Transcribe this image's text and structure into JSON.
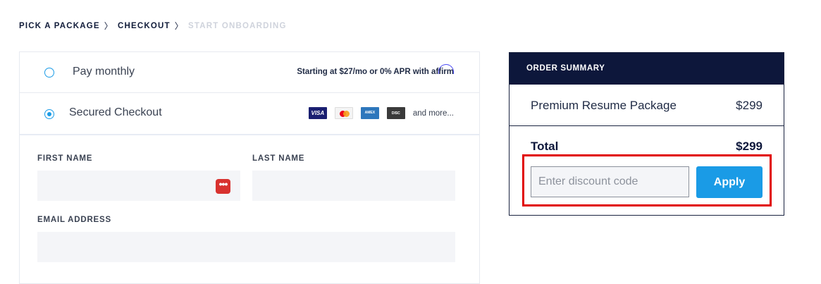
{
  "breadcrumb": {
    "steps": [
      "PICK A PACKAGE",
      "CHECKOUT",
      "START ONBOARDING"
    ],
    "separator": "〉"
  },
  "payment": {
    "monthly_label": "Pay monthly",
    "affirm_prefix": "Starting at $27/mo or 0% APR with",
    "affirm_brand": "affirm",
    "secured_label": "Secured Checkout",
    "cards": [
      "VISA",
      "mastercard",
      "AMERICAN EXPRESS",
      "DISCOVER"
    ],
    "more_label": "and more...",
    "selected": "Secured Checkout"
  },
  "form": {
    "first_name_label": "FIRST NAME",
    "last_name_label": "LAST NAME",
    "email_label": "EMAIL ADDRESS",
    "first_name_value": "",
    "last_name_value": "",
    "email_value": ""
  },
  "summary": {
    "header": "ORDER SUMMARY",
    "item_name": "Premium Resume Package",
    "item_price": "$299",
    "total_label": "Total",
    "total_price": "$299",
    "discount_placeholder": "Enter discount code",
    "apply_label": "Apply"
  },
  "colors": {
    "accent": "#1a9be6",
    "navy": "#0d173b",
    "highlight": "#e10000"
  }
}
